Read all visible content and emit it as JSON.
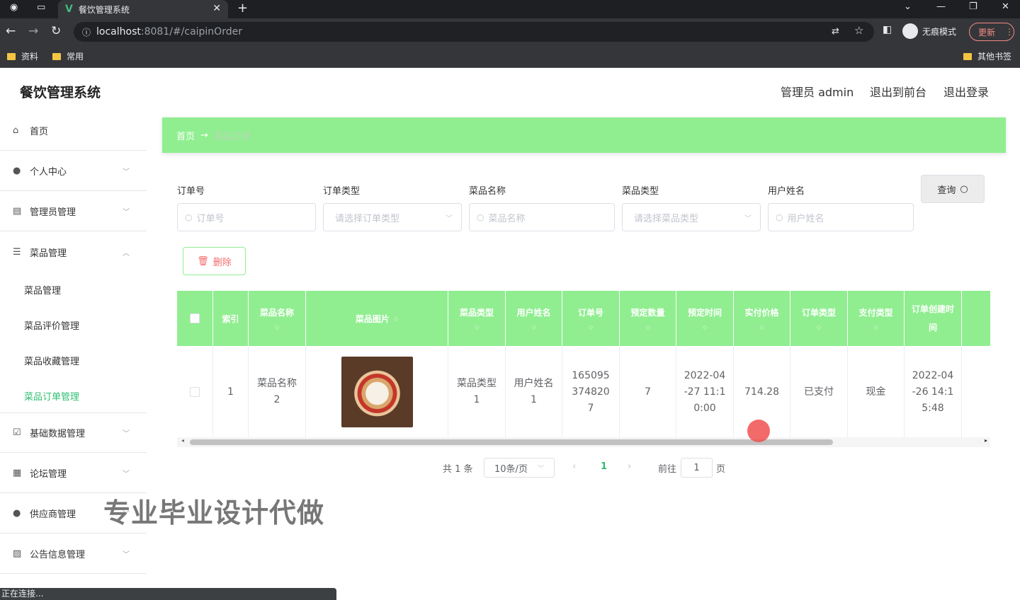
{
  "browser": {
    "tab_title": "餐饮管理系统",
    "url_host": "localhost",
    "url_path": ":8081/#/caipinOrder",
    "incognito_label": "无痕模式",
    "update_label": "更新",
    "bookmarks": [
      "资料",
      "常用"
    ],
    "other_bookmarks": "其他书签",
    "status_text": "正在连接..."
  },
  "header": {
    "title": "餐饮管理系统",
    "admin": "管理员 admin",
    "to_front": "退出到前台",
    "logout": "退出登录"
  },
  "sidebar": {
    "items": [
      {
        "label": "首页",
        "icon": "home-icon"
      },
      {
        "label": "个人中心",
        "icon": "user-icon"
      },
      {
        "label": "管理员管理",
        "icon": "doc-icon"
      },
      {
        "label": "菜品管理",
        "icon": "settings-icon"
      },
      {
        "label": "基础数据管理",
        "icon": "check-icon"
      },
      {
        "label": "论坛管理",
        "icon": "forum-icon"
      },
      {
        "label": "供应商管理",
        "icon": "user-icon"
      },
      {
        "label": "公告信息管理",
        "icon": "chart-icon"
      }
    ],
    "sub_items": [
      "菜品管理",
      "菜品评价管理",
      "菜品收藏管理",
      "菜品订单管理"
    ]
  },
  "breadcrumb": {
    "home": "首页",
    "current": "菜品订单"
  },
  "filters": {
    "order_no": {
      "label": "订单号",
      "placeholder": "订单号"
    },
    "order_type": {
      "label": "订单类型",
      "placeholder": "请选择订单类型"
    },
    "dish_name": {
      "label": "菜品名称",
      "placeholder": "菜品名称"
    },
    "dish_type": {
      "label": "菜品类型",
      "placeholder": "请选择菜品类型"
    },
    "user_name": {
      "label": "用户姓名",
      "placeholder": "用户姓名"
    },
    "query_label": "查询"
  },
  "delete_label": "删除",
  "table": {
    "columns": [
      "索引",
      "菜品名称",
      "菜品图片",
      "菜品类型",
      "用户姓名",
      "订单号",
      "预定数量",
      "预定时间",
      "实付价格",
      "订单类型",
      "支付类型",
      "订单创建时间"
    ],
    "rows": [
      {
        "index": "1",
        "dish_name": "菜品名称2",
        "dish_type": "菜品类型1",
        "user_name": "用户姓名1",
        "order_no": "1650953748207",
        "qty": "7",
        "time": "2022-04-27 11:10:00",
        "price": "714.28",
        "order_type": "已支付",
        "pay_type": "现金",
        "created": "2022-04-26 14:15:48"
      }
    ]
  },
  "pagination": {
    "total": "共 1 条",
    "page_size": "10条/页",
    "current": "1",
    "goto_label": "前往",
    "goto_value": "1",
    "page_unit": "页"
  },
  "watermark": "专业毕业设计代做",
  "colors": {
    "accent": "#90ee90",
    "active": "#2fbf71",
    "danger": "#f56c6c"
  }
}
